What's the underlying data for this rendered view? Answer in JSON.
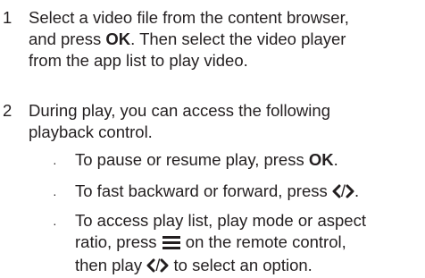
{
  "steps": [
    {
      "number": "1",
      "lines": [
        "Select a video file from the content browser,",
        "and press ",
        "OK",
        ". Then select the video player",
        "from the app list to play video."
      ]
    },
    {
      "number": "2",
      "lines": [
        "During play, you can access the following",
        "playback control."
      ]
    }
  ],
  "bullets": [
    {
      "symbol": "·",
      "pre": "To pause or resume play, press ",
      "bold": "OK",
      "post": "."
    },
    {
      "symbol": "·",
      "pre": "To fast backward or forward, press ",
      "icon_names": [
        "left-arrow-icon",
        "right-arrow-icon"
      ],
      "slash": "/",
      "post": "."
    },
    {
      "symbol": "·",
      "line1_pre": "To access play list, play mode or aspect",
      "line2_pre": "ratio, press ",
      "menu_icon": "menu-icon",
      "line2_post": " on the remote control,",
      "line3_pre": "then play ",
      "slash": "/",
      "line3_post": " to select an option."
    }
  ]
}
